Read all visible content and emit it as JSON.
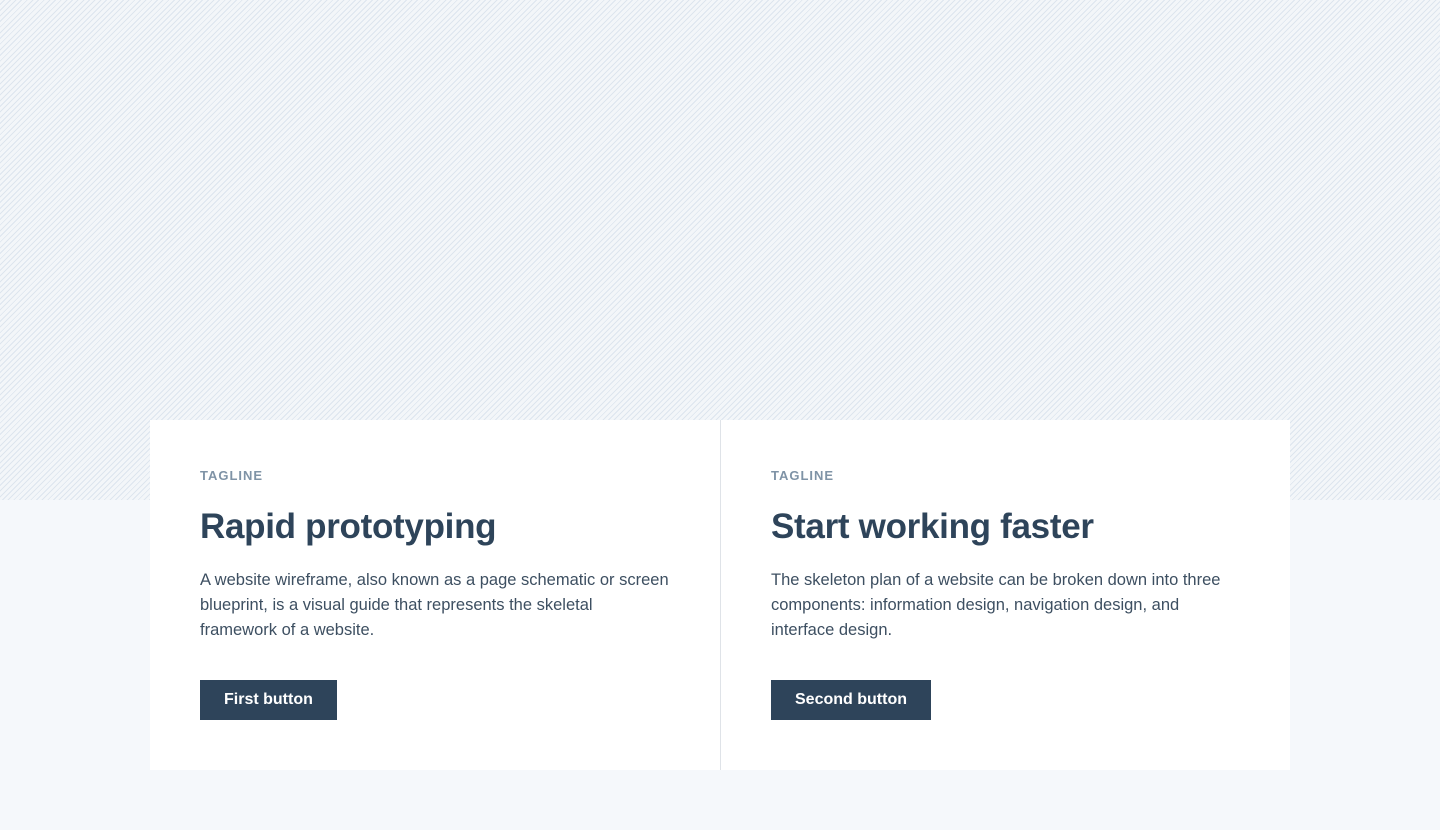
{
  "colors": {
    "page_background": "#f5f8fb",
    "hero_background": "#f0f4f8",
    "hero_stripe": "#dde5ee",
    "card_background": "#ffffff",
    "heading": "#2e445a",
    "tagline": "#7f93a6",
    "body_text": "#3d4f61",
    "button_background": "#2e445a",
    "button_text": "#ffffff"
  },
  "cards": [
    {
      "tagline": "TAGLINE",
      "title": "Rapid prototyping",
      "description": "A website wireframe, also known as a page schematic or screen blueprint, is a visual guide that represents the skeletal framework of a website.",
      "button_label": "First button"
    },
    {
      "tagline": "TAGLINE",
      "title": "Start working faster",
      "description": "The skeleton plan of a website can be broken down into three components: information design, navigation design, and interface design.",
      "button_label": "Second button"
    }
  ]
}
